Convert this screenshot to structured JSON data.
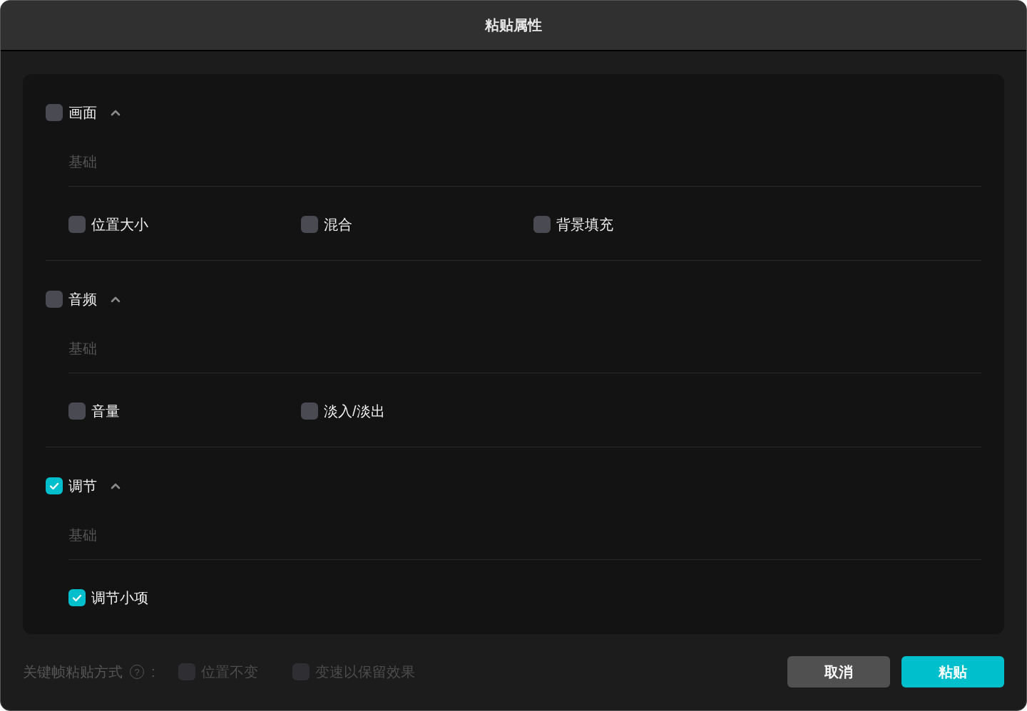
{
  "window": {
    "title": "粘贴属性"
  },
  "sections": [
    {
      "label": "画面",
      "checked": false,
      "expanded": true,
      "group": "基础",
      "items": [
        {
          "label": "位置大小",
          "checked": false
        },
        {
          "label": "混合",
          "checked": false
        },
        {
          "label": "背景填充",
          "checked": false
        }
      ]
    },
    {
      "label": "音频",
      "checked": false,
      "expanded": true,
      "group": "基础",
      "items": [
        {
          "label": "音量",
          "checked": false
        },
        {
          "label": "淡入/淡出",
          "checked": false
        }
      ]
    },
    {
      "label": "调节",
      "checked": true,
      "expanded": true,
      "group": "基础",
      "items": [
        {
          "label": "调节小项",
          "checked": true
        }
      ]
    }
  ],
  "keyframe_mode": {
    "label": "关键帧粘贴方式",
    "help": "?",
    "colon": ":",
    "options": [
      {
        "label": "位置不变",
        "checked": false,
        "disabled": true
      },
      {
        "label": "变速以保留效果",
        "checked": false,
        "disabled": true
      }
    ]
  },
  "buttons": [
    {
      "label": "取消",
      "kind": "secondary"
    },
    {
      "label": "粘贴",
      "kind": "primary"
    }
  ]
}
